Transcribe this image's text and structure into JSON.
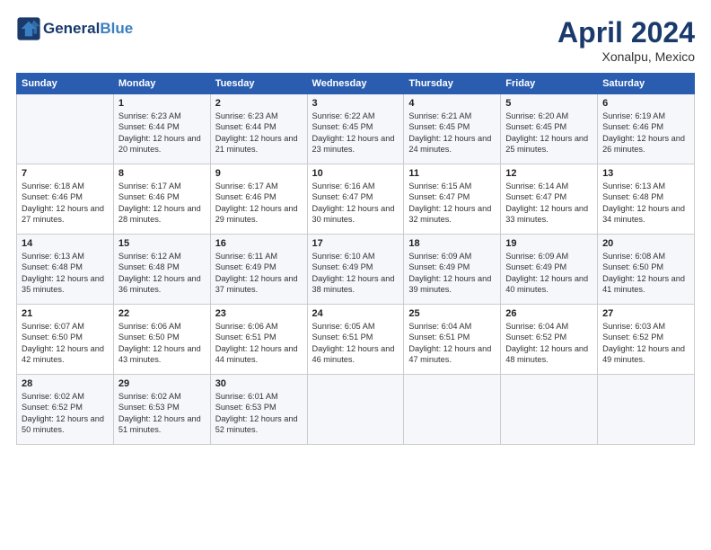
{
  "header": {
    "logo_line1": "General",
    "logo_line2": "Blue",
    "month": "April 2024",
    "location": "Xonalpu, Mexico"
  },
  "columns": [
    "Sunday",
    "Monday",
    "Tuesday",
    "Wednesday",
    "Thursday",
    "Friday",
    "Saturday"
  ],
  "weeks": [
    [
      {
        "day": "",
        "sunrise": "",
        "sunset": "",
        "daylight": ""
      },
      {
        "day": "1",
        "sunrise": "6:23 AM",
        "sunset": "6:44 PM",
        "daylight": "12 hours and 20 minutes."
      },
      {
        "day": "2",
        "sunrise": "6:23 AM",
        "sunset": "6:44 PM",
        "daylight": "12 hours and 21 minutes."
      },
      {
        "day": "3",
        "sunrise": "6:22 AM",
        "sunset": "6:45 PM",
        "daylight": "12 hours and 23 minutes."
      },
      {
        "day": "4",
        "sunrise": "6:21 AM",
        "sunset": "6:45 PM",
        "daylight": "12 hours and 24 minutes."
      },
      {
        "day": "5",
        "sunrise": "6:20 AM",
        "sunset": "6:45 PM",
        "daylight": "12 hours and 25 minutes."
      },
      {
        "day": "6",
        "sunrise": "6:19 AM",
        "sunset": "6:46 PM",
        "daylight": "12 hours and 26 minutes."
      }
    ],
    [
      {
        "day": "7",
        "sunrise": "6:18 AM",
        "sunset": "6:46 PM",
        "daylight": "12 hours and 27 minutes."
      },
      {
        "day": "8",
        "sunrise": "6:17 AM",
        "sunset": "6:46 PM",
        "daylight": "12 hours and 28 minutes."
      },
      {
        "day": "9",
        "sunrise": "6:17 AM",
        "sunset": "6:46 PM",
        "daylight": "12 hours and 29 minutes."
      },
      {
        "day": "10",
        "sunrise": "6:16 AM",
        "sunset": "6:47 PM",
        "daylight": "12 hours and 30 minutes."
      },
      {
        "day": "11",
        "sunrise": "6:15 AM",
        "sunset": "6:47 PM",
        "daylight": "12 hours and 32 minutes."
      },
      {
        "day": "12",
        "sunrise": "6:14 AM",
        "sunset": "6:47 PM",
        "daylight": "12 hours and 33 minutes."
      },
      {
        "day": "13",
        "sunrise": "6:13 AM",
        "sunset": "6:48 PM",
        "daylight": "12 hours and 34 minutes."
      }
    ],
    [
      {
        "day": "14",
        "sunrise": "6:13 AM",
        "sunset": "6:48 PM",
        "daylight": "12 hours and 35 minutes."
      },
      {
        "day": "15",
        "sunrise": "6:12 AM",
        "sunset": "6:48 PM",
        "daylight": "12 hours and 36 minutes."
      },
      {
        "day": "16",
        "sunrise": "6:11 AM",
        "sunset": "6:49 PM",
        "daylight": "12 hours and 37 minutes."
      },
      {
        "day": "17",
        "sunrise": "6:10 AM",
        "sunset": "6:49 PM",
        "daylight": "12 hours and 38 minutes."
      },
      {
        "day": "18",
        "sunrise": "6:09 AM",
        "sunset": "6:49 PM",
        "daylight": "12 hours and 39 minutes."
      },
      {
        "day": "19",
        "sunrise": "6:09 AM",
        "sunset": "6:49 PM",
        "daylight": "12 hours and 40 minutes."
      },
      {
        "day": "20",
        "sunrise": "6:08 AM",
        "sunset": "6:50 PM",
        "daylight": "12 hours and 41 minutes."
      }
    ],
    [
      {
        "day": "21",
        "sunrise": "6:07 AM",
        "sunset": "6:50 PM",
        "daylight": "12 hours and 42 minutes."
      },
      {
        "day": "22",
        "sunrise": "6:06 AM",
        "sunset": "6:50 PM",
        "daylight": "12 hours and 43 minutes."
      },
      {
        "day": "23",
        "sunrise": "6:06 AM",
        "sunset": "6:51 PM",
        "daylight": "12 hours and 44 minutes."
      },
      {
        "day": "24",
        "sunrise": "6:05 AM",
        "sunset": "6:51 PM",
        "daylight": "12 hours and 46 minutes."
      },
      {
        "day": "25",
        "sunrise": "6:04 AM",
        "sunset": "6:51 PM",
        "daylight": "12 hours and 47 minutes."
      },
      {
        "day": "26",
        "sunrise": "6:04 AM",
        "sunset": "6:52 PM",
        "daylight": "12 hours and 48 minutes."
      },
      {
        "day": "27",
        "sunrise": "6:03 AM",
        "sunset": "6:52 PM",
        "daylight": "12 hours and 49 minutes."
      }
    ],
    [
      {
        "day": "28",
        "sunrise": "6:02 AM",
        "sunset": "6:52 PM",
        "daylight": "12 hours and 50 minutes."
      },
      {
        "day": "29",
        "sunrise": "6:02 AM",
        "sunset": "6:53 PM",
        "daylight": "12 hours and 51 minutes."
      },
      {
        "day": "30",
        "sunrise": "6:01 AM",
        "sunset": "6:53 PM",
        "daylight": "12 hours and 52 minutes."
      },
      {
        "day": "",
        "sunrise": "",
        "sunset": "",
        "daylight": ""
      },
      {
        "day": "",
        "sunrise": "",
        "sunset": "",
        "daylight": ""
      },
      {
        "day": "",
        "sunrise": "",
        "sunset": "",
        "daylight": ""
      },
      {
        "day": "",
        "sunrise": "",
        "sunset": "",
        "daylight": ""
      }
    ]
  ]
}
